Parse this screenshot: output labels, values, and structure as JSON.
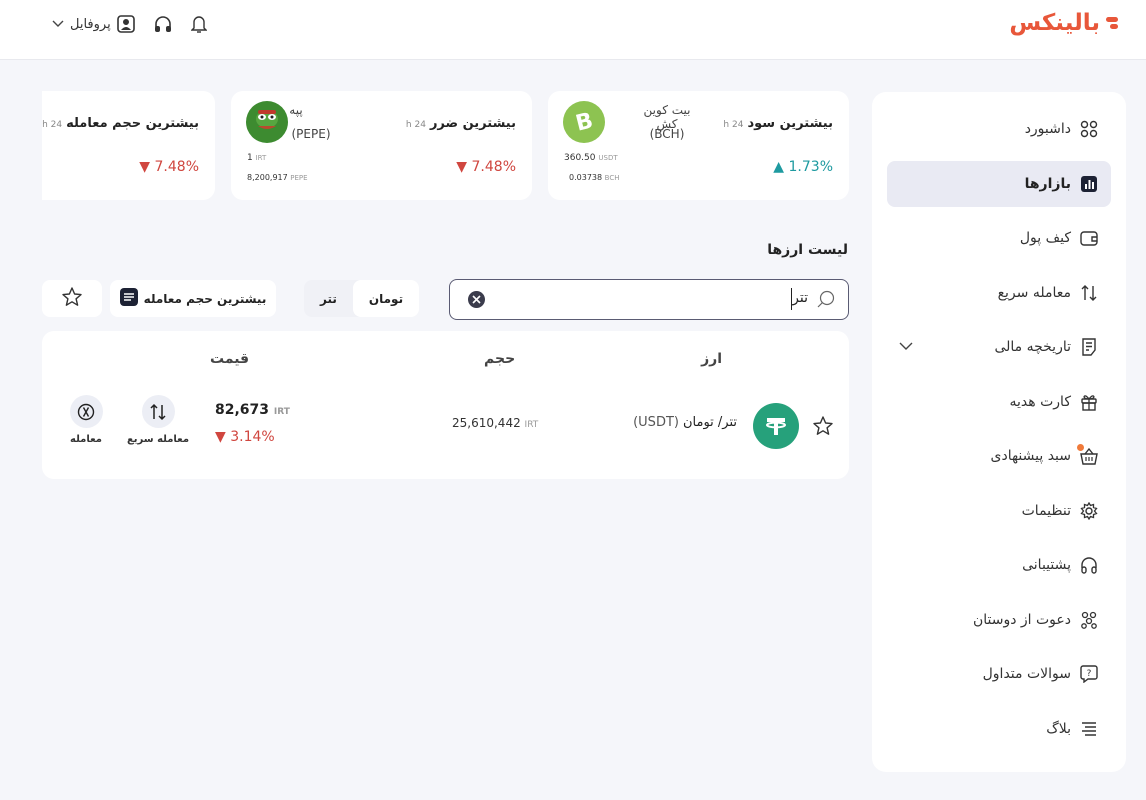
{
  "brand": {
    "logo_text": "بالینکس",
    "color": "#e8573a"
  },
  "topbar": {
    "profile_label": "پروفایل",
    "icons": [
      "bell-icon",
      "headset-icon",
      "profile-icon",
      "chevron-down-icon"
    ]
  },
  "sidebar": {
    "items": [
      {
        "label": "داشبورد",
        "icon": "dashboard-grid-icon"
      },
      {
        "label": "بازارها",
        "icon": "chart-icon",
        "active": true
      },
      {
        "label": "کیف پول",
        "icon": "wallet-icon"
      },
      {
        "label": "معامله سریع",
        "icon": "swap-arrows-icon"
      },
      {
        "label": "تاریخچه مالی",
        "icon": "receipt-icon"
      },
      {
        "label": "کارت هدیه",
        "icon": "gift-icon"
      },
      {
        "label": "سبد پیشنهادی",
        "icon": "basket-icon"
      },
      {
        "label": "تنظیمات",
        "icon": "gear-icon"
      },
      {
        "label": "پشتیبانی",
        "icon": "headset-icon"
      },
      {
        "label": "دعوت از دوستان",
        "icon": "users-icon"
      },
      {
        "label": "سوالات متداول",
        "icon": "question-icon"
      },
      {
        "label": "بلاگ",
        "icon": "menu-lines-icon"
      }
    ]
  },
  "cards": [
    {
      "title": "بیشترین سود",
      "period": "24 h",
      "change": "1.73%",
      "direction": "up",
      "coin_name": "بیت کوین کش",
      "coin_symbol": "(BCH)",
      "line1_value": "360.50",
      "line1_unit": "USDT",
      "line2_value": "0.03738",
      "line2_unit": "BCH",
      "avatar_color": "#8dc351"
    },
    {
      "title": "بیشترین ضرر",
      "period": "24 h",
      "change": "7.48%",
      "direction": "down",
      "coin_name": "پپه",
      "coin_symbol": "(PEPE)",
      "line1_value": "1",
      "line1_unit": "IRT",
      "line2_value": "8,200,917",
      "line2_unit": "PEPE",
      "avatar_color": "#3d8b30"
    },
    {
      "title": "بیشترین حجم معامله",
      "period": "24 h",
      "change": "7.48%",
      "direction": "down"
    }
  ],
  "list_title": "لیست ارزها",
  "search": {
    "value": "تتر"
  },
  "filters": {
    "sort_label": "بیشترین حجم معامله",
    "tabs": [
      "تتر",
      "تومان"
    ],
    "active_tab": "تومان"
  },
  "table": {
    "headers": {
      "asset": "ارز",
      "volume": "حجم",
      "price": "قیمت"
    },
    "rows": [
      {
        "pair": "تتر/ تومان",
        "symbol": "(USDT)",
        "volume": "25,610,442",
        "volume_unit": "IRT",
        "price": "82,673",
        "price_unit": "IRT",
        "change": "3.14%",
        "direction": "down",
        "quick_trade_label": "معامله سریع",
        "trade_label": "معامله"
      }
    ]
  },
  "colors": {
    "up": "#1e9aa0",
    "down": "#d0463f",
    "tether": "#26a17b",
    "bch": "#8dc351"
  }
}
